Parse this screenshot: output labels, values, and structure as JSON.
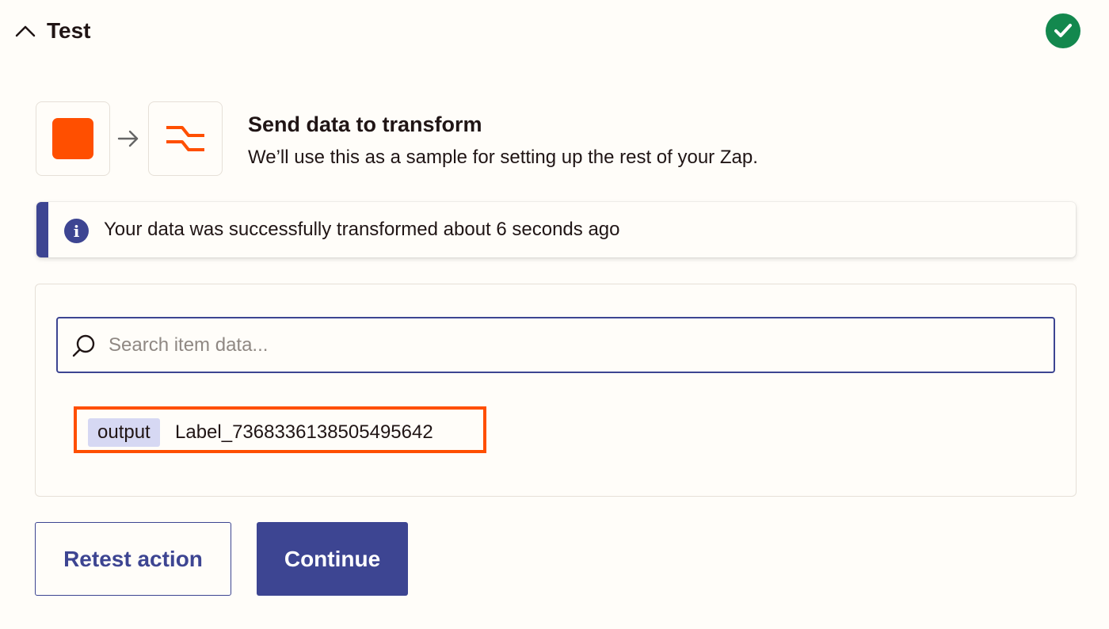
{
  "section": {
    "title": "Test",
    "collapse_icon": "chevron-up-icon",
    "status_icon": "check-circle-icon",
    "status_color": "#13884e"
  },
  "step": {
    "source_app_icon": "orange-square-icon",
    "arrow_icon": "arrow-right-icon",
    "target_app_icon": "formatter-icon",
    "title": "Send data to transform",
    "description": "We’ll use this as a sample for setting up the rest of your Zap."
  },
  "info_banner": {
    "icon": "info-icon",
    "text": "Your data was successfully transformed about 6 seconds ago"
  },
  "data_panel": {
    "search": {
      "placeholder": "Search item data...",
      "value": ""
    },
    "items": [
      {
        "key": "output",
        "value": "Label_7368336138505495642"
      }
    ]
  },
  "actions": {
    "retest_label": "Retest action",
    "continue_label": "Continue"
  },
  "colors": {
    "accent": "#3d4592",
    "brand_orange": "#ff4f00",
    "success": "#13884e",
    "key_badge": "#d6d8f3",
    "background": "#fffdf9"
  }
}
